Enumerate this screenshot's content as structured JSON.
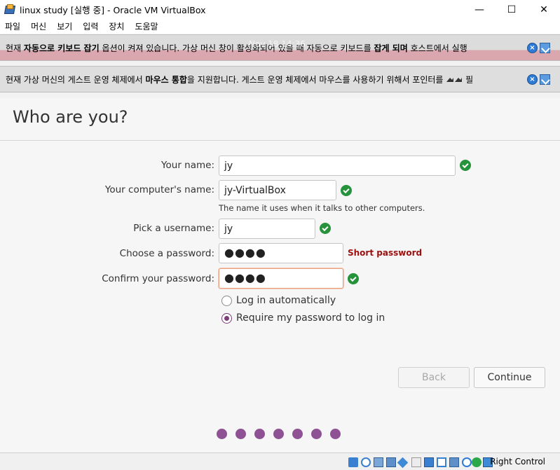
{
  "window": {
    "title": "linux study [실행 중] - Oracle VM VirtualBox",
    "minimize_glyph": "—",
    "maximize_glyph": "☐",
    "close_glyph": "✕"
  },
  "menubar": {
    "items": [
      "파일",
      "머신",
      "보기",
      "입력",
      "장치",
      "도움말"
    ]
  },
  "notices": {
    "keyboard": {
      "pre": "현재 ",
      "b1": "자동으로 키보드 잡기",
      "mid1": " 옵션이 켜져 있습니다. 가상 머신 창이 활성화되어 있을 때 자동으로 키보드를 ",
      "b2": "잡게 되며",
      "post": " 호스트에서 실행",
      "ghost_time": "Nov 18  14:36"
    },
    "mouse": {
      "pre": "현재 가상 머신의 게스트 운영 체제에서 ",
      "b1": "마우스 통합",
      "mid1": "을 지원합니다. 게스트 운영 체제에서 마우스를 사용하기 위해서 포인터를 ",
      "post": " 필"
    }
  },
  "installer": {
    "title": "Who are you?",
    "fields": {
      "name_label": "Your name:",
      "name_value": "jy",
      "computer_label": "Your computer's name:",
      "computer_value": "jy-VirtualBox",
      "computer_hint": "The name it uses when it talks to other computers.",
      "username_label": "Pick a username:",
      "username_value": "jy",
      "password_label": "Choose a password:",
      "password_value": "●●●●",
      "password_strength": "Short password",
      "confirm_label": "Confirm your password:",
      "confirm_value": "●●●●"
    },
    "options": {
      "auto_login": "Log in automatically",
      "require_password": "Require my password to log in",
      "selected": "require_password"
    },
    "buttons": {
      "back": "Back",
      "continue": "Continue"
    },
    "progress": {
      "total_steps": 7
    }
  },
  "statusbar": {
    "host_key": "Right Control"
  },
  "colors": {
    "accent": "#8e5194",
    "check": "#26923c",
    "warning": "#9c1010"
  }
}
